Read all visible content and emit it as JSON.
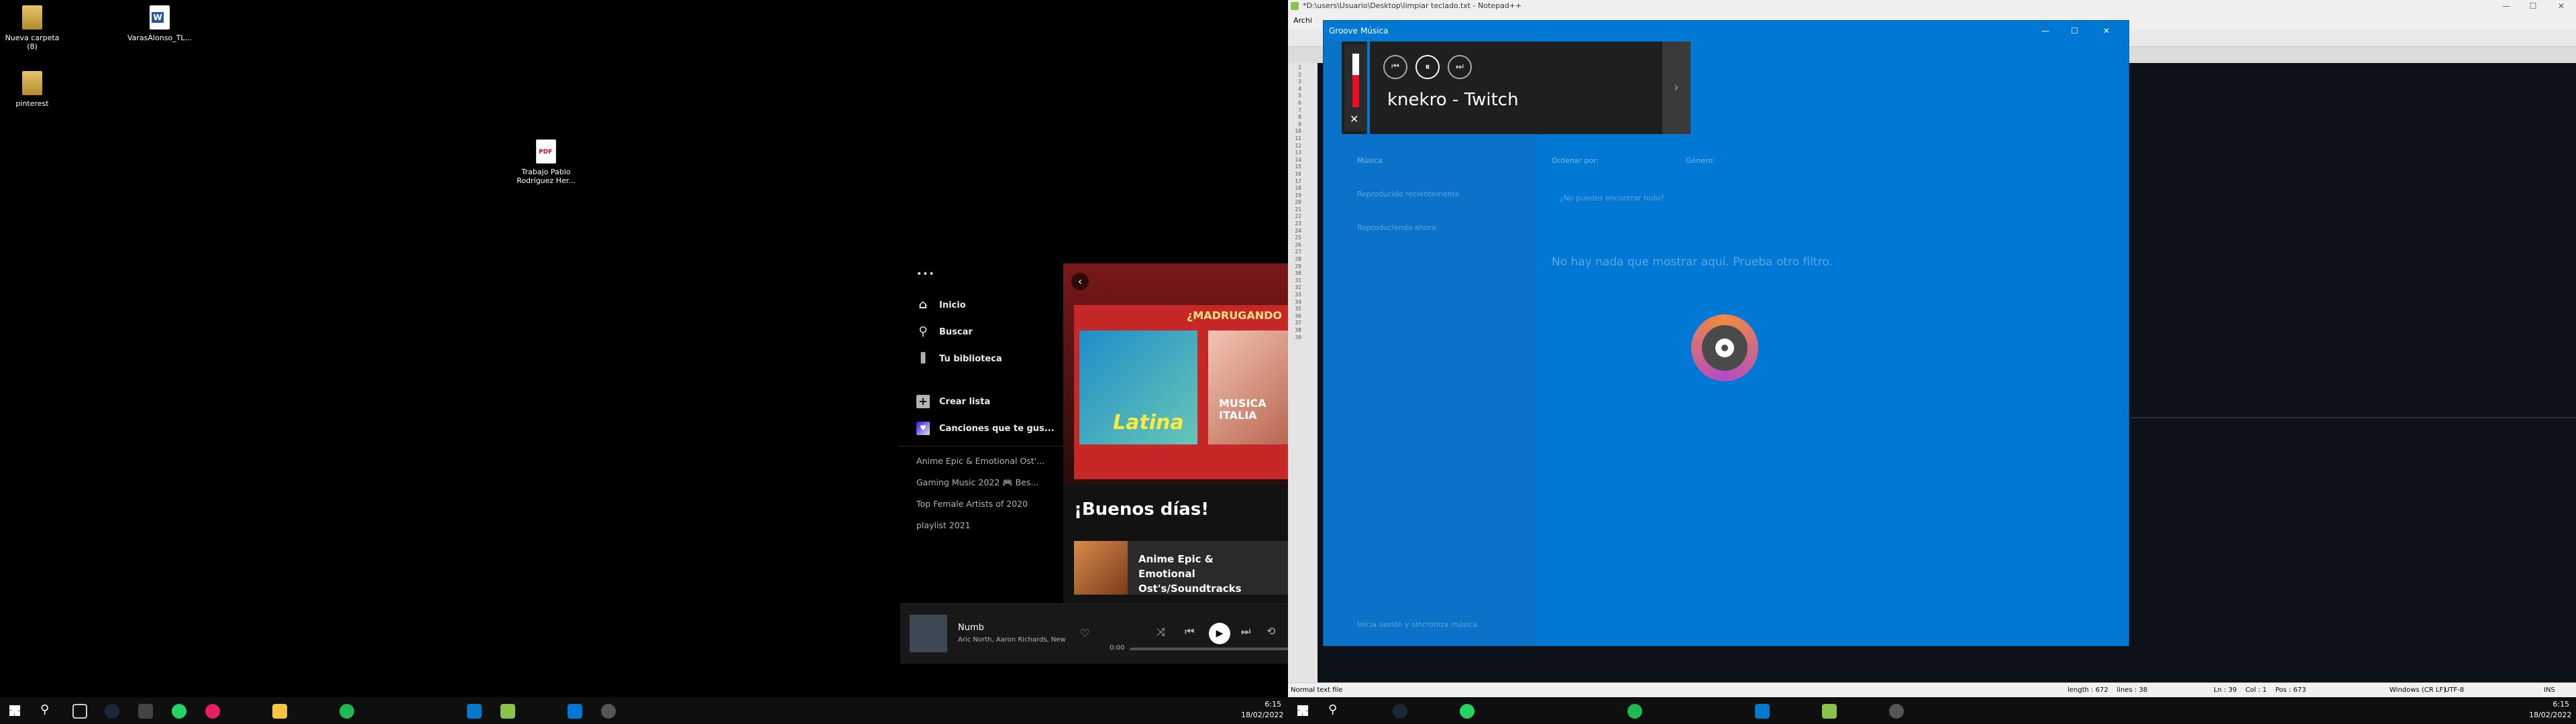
{
  "desktop": {
    "icons": [
      {
        "label": "Nueva carpeta (8)"
      },
      {
        "label": "VarasAlonso_TL..."
      },
      {
        "label": "pinterest"
      },
      {
        "label": "Trabajo Pablo Rodríguez Her..."
      }
    ]
  },
  "spotify": {
    "menu_dots": "•••",
    "nav": [
      {
        "label": "Inicio",
        "icon": "home-icon"
      },
      {
        "label": "Buscar",
        "icon": "search-icon"
      },
      {
        "label": "Tu biblioteca",
        "icon": "library-icon"
      }
    ],
    "create_playlist": "Crear lista",
    "liked_songs": "Canciones que te gus...",
    "playlists": [
      "Anime Epic & Emotional Ost'...",
      "Gaming Music 2022 🎮 Bes...",
      "Top Female Artists of 2020",
      "playlist 2021"
    ],
    "banner_text": "¿MADRUGANDO",
    "cover_1_text": "Latina",
    "cover_2_text": "MUSICA ITALIA",
    "greeting": "¡Buenos días!",
    "recent_card": "Anime Epic & Emotional Ost's/Soundtracks",
    "player": {
      "track": "Numb",
      "artists": "Aric North, Aaron Richards, New J...",
      "time": "0:00"
    }
  },
  "notepad": {
    "title": "*D:\\users\\Usuario\\Desktop\\limpiar teclado.txt - Notepad++",
    "menu_first": "Archi",
    "status": {
      "type": "Normal text file",
      "length": "length : 672    lines : 38",
      "position": "Ln : 39    Col : 1    Pos : 673",
      "eol": "Windows (CR LF)",
      "encoding": "UTF-8",
      "mode": "INS"
    },
    "line_numbers": [
      "1",
      "2",
      "3",
      "4",
      "5",
      "6",
      "7",
      "8",
      "9",
      "10",
      "11",
      "12",
      "13",
      "14",
      "15",
      "16",
      "17",
      "18",
      "19",
      "20",
      "21",
      "22",
      "23",
      "24",
      "25",
      "26",
      "27",
      "28",
      "29",
      "30",
      "31",
      "32",
      "33",
      "34",
      "35",
      "36",
      "37",
      "38",
      "39"
    ]
  },
  "groove": {
    "title": "Groove Música",
    "now_playing": "knekro - Twitch",
    "left_items": [
      "Música",
      "Reproducido recientemente",
      "Reproduciendo ahora"
    ],
    "sort_label": "Ordenar por:",
    "filter_label": "Género:",
    "empty_message": "No hay nada que mostrar aquí. Prueba otro filtro.",
    "cannot_find": "¿No puedes encontrar todo?",
    "sign_in": "Inicia sesión y sincroniza música"
  },
  "taskbar": {
    "time": "6:15",
    "date": "18/02/2022"
  },
  "colors": {
    "groove_blue": "#0078d4",
    "spotify_green": "#1db954",
    "mini_player_bg": "#1f1f1f"
  }
}
